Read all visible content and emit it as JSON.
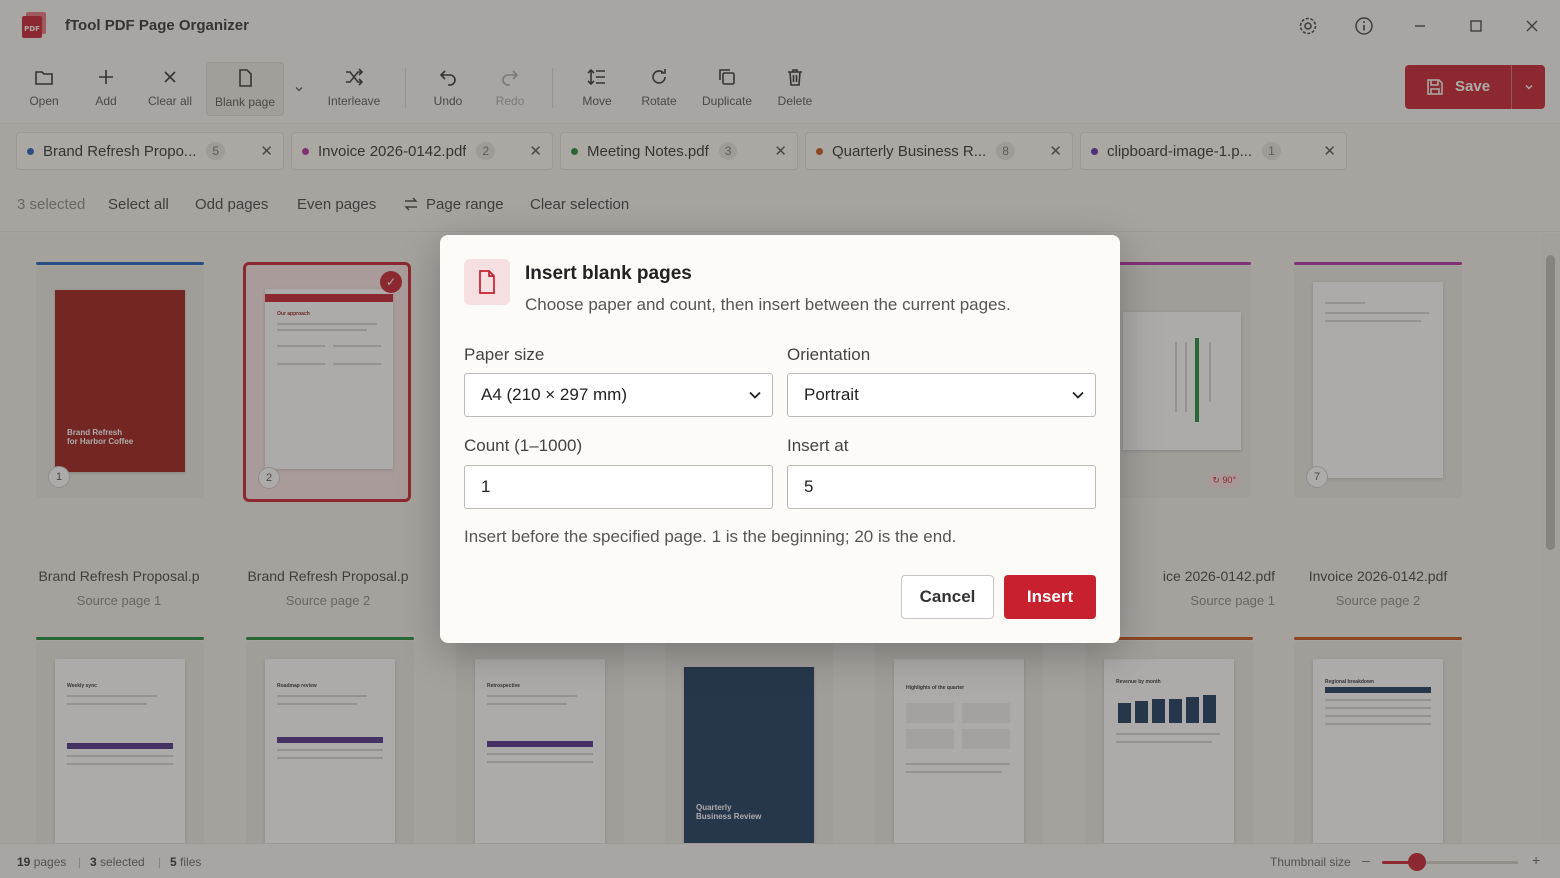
{
  "app": {
    "title": "fTool PDF Page Organizer"
  },
  "toolbar": {
    "open": "Open",
    "add": "Add",
    "clear_all": "Clear all",
    "blank_page": "Blank page",
    "interleave": "Interleave",
    "undo": "Undo",
    "redo": "Redo",
    "move": "Move",
    "rotate": "Rotate",
    "duplicate": "Duplicate",
    "delete": "Delete",
    "save": "Save"
  },
  "file_tabs": [
    {
      "name": "Brand Refresh Propo...",
      "count": "5",
      "color": "#1f5fbf"
    },
    {
      "name": "Invoice 2026-0142.pdf",
      "count": "2",
      "color": "#b42fa8"
    },
    {
      "name": "Meeting Notes.pdf",
      "count": "3",
      "color": "#1f8a3a"
    },
    {
      "name": "Quarterly Business R...",
      "count": "8",
      "color": "#c4541a"
    },
    {
      "name": "clipboard-image-1.p...",
      "count": "1",
      "color": "#5a2fa8"
    }
  ],
  "selection": {
    "count": "3 selected",
    "select_all": "Select all",
    "odd": "Odd pages",
    "even": "Even pages",
    "range": "Page range",
    "clear": "Clear selection"
  },
  "grid": {
    "cards": [
      {
        "title": "Brand Refresh Proposal.p",
        "sub": "Source page 1",
        "num": "1",
        "cover_title": "Brand Refresh\nfor Harbor Coffee"
      },
      {
        "title": "Brand Refresh Proposal.p",
        "sub": "Source page 2",
        "num": "2",
        "heading": "Our approach"
      },
      {
        "title": "ice 2026-0142.pdf",
        "sub": "Source page 1",
        "rotation": "↻ 90°"
      },
      {
        "title": "Invoice 2026-0142.pdf",
        "sub": "Source page 2",
        "num": "7"
      }
    ],
    "row2": [
      {
        "heading": "Weekly sync"
      },
      {
        "heading": "Roadmap review"
      },
      {
        "heading": "Retrospective"
      },
      {
        "cover": "Quarterly\nBusiness Review"
      },
      {
        "heading": "Highlights of the quarter"
      },
      {
        "heading": "Revenue by month"
      },
      {
        "heading": "Regional breakdown"
      }
    ]
  },
  "status": {
    "pages_num": "19",
    "pages_lbl": "pages",
    "selected_num": "3",
    "selected_lbl": "selected",
    "files_num": "5",
    "files_lbl": "files",
    "thumb_size": "Thumbnail size",
    "zoom_level": 0.26
  },
  "dialog": {
    "title": "Insert blank pages",
    "subtitle": "Choose paper and count, then insert between the current pages.",
    "paper_size_label": "Paper size",
    "paper_size_value": "A4 (210 × 297 mm)",
    "orientation_label": "Orientation",
    "orientation_value": "Portrait",
    "count_label": "Count (1–1000)",
    "count_value": "1",
    "insert_at_label": "Insert at",
    "insert_at_value": "5",
    "hint": "Insert before the specified page. 1 is the beginning; 20 is the end.",
    "cancel": "Cancel",
    "insert": "Insert"
  },
  "colors": {
    "accent": "#c7202f"
  }
}
